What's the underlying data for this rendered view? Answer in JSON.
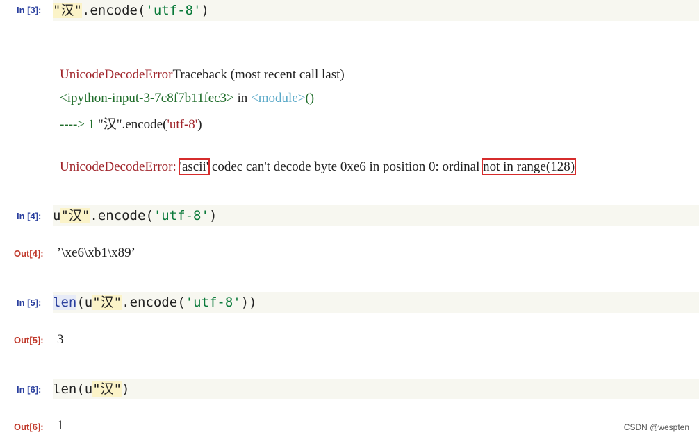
{
  "cells": [
    {
      "in_prompt": "In [3]:",
      "code": {
        "str": "\"汉\"",
        "rest": ".encode(",
        "arg": "'utf-8'",
        "close": ")"
      }
    },
    {
      "in_prompt": "In [4]:",
      "code": {
        "prefix": "u",
        "str": "\"汉\"",
        "rest": ".encode(",
        "arg": "'utf-8'",
        "close": ")"
      },
      "out_prompt": "Out[4]:",
      "out_value": "’\\xe6\\xb1\\x89’"
    },
    {
      "in_prompt": "In [5]:",
      "code": {
        "func": "len",
        "open": "(",
        "prefix": "u",
        "str": "\"汉\"",
        "rest": ".encode(",
        "arg": "'utf-8'",
        "close": "))"
      },
      "out_prompt": "Out[5]:",
      "out_value": "3"
    },
    {
      "in_prompt": "In [6]:",
      "code": {
        "func": "len",
        "open": "(",
        "prefix": "u",
        "str": "\"汉\"",
        "close": ")"
      },
      "out_prompt": "Out[6]:",
      "out_value": "1"
    }
  ],
  "traceback": {
    "line1_error": "UnicodeDecodeError",
    "line1_rest": "Traceback (most recent call last)",
    "line2_input": "<ipython-input-3-7c8f7b11fec3>",
    "line2_in": " in ",
    "line2_module": "<module>",
    "line2_parens": "()",
    "line3_arrow": "----> 1 ",
    "line3_str": "\"汉\"",
    "line3_encode": ".encode(",
    "line3_arg": "'utf-8'",
    "line3_close": ")",
    "line4_error": "UnicodeDecodeError:",
    "line4_ascii": "'ascii'",
    "line4_mid": "codec can't decode byte 0xe6 in position 0: ordinal ",
    "line4_range": "not in range(128)"
  },
  "colors": {
    "in_prompt": "#2a3f9e",
    "out_prompt": "#c0392b",
    "error_red": "#a1262c",
    "highlight_box": "#d62c2c"
  },
  "watermark": "CSDN @wespten"
}
